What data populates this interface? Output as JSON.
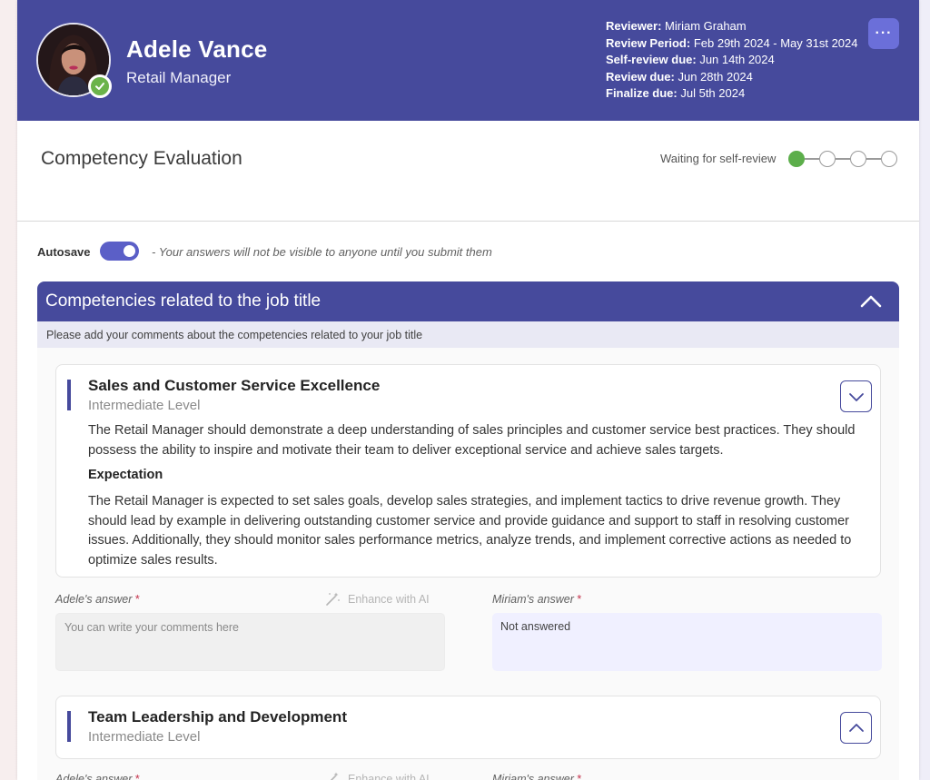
{
  "header": {
    "name": "Adele Vance",
    "role": "Retail Manager",
    "meta": [
      {
        "label": "Reviewer:",
        "value": "Miriam Graham"
      },
      {
        "label": "Review Period:",
        "value": "Feb 29th 2024 - May 31st 2024"
      },
      {
        "label": "Self-review due:",
        "value": "Jun 14th 2024"
      },
      {
        "label": "Review due:",
        "value": "Jun 28th 2024"
      },
      {
        "label": "Finalize due:",
        "value": "Jul 5th 2024"
      }
    ],
    "more_label": "···",
    "presence_icon": "check-icon",
    "colors": {
      "header_bg": "#464a9c",
      "accent": "#5b5fc7",
      "presence": "#6bb34a"
    }
  },
  "evaluation": {
    "title": "Competency Evaluation",
    "status": "Waiting for self-review",
    "steps_total": 4,
    "steps_done": 1
  },
  "autosave": {
    "label": "Autosave",
    "enabled": true,
    "note": "- Your answers will not be visible to anyone until you submit them"
  },
  "section": {
    "title": "Competencies related to the job title",
    "subtitle": "Please add your comments about the competencies related to your job title",
    "collapse_icon": "chevron-up-icon"
  },
  "competencies": [
    {
      "title": "Sales and Customer Service Excellence",
      "level": "Intermediate Level",
      "description": "The Retail Manager should demonstrate a deep understanding of sales principles and customer service best practices. They should possess the ability to inspire and motivate their team to deliver exceptional service and achieve sales targets.",
      "expectation_label": "Expectation",
      "expectation": "The Retail Manager is expected to set sales goals, develop sales strategies, and implement tactics to drive revenue growth. They should lead by example in delivering outstanding customer service and provide guidance and support to staff in resolving customer issues. Additionally, they should monitor sales performance metrics, analyze trends, and implement corrective actions as needed to optimize sales results.",
      "toggle_icon": "chevron-down-icon",
      "own_label": "Adele's answer",
      "other_label": "Miriam's answer",
      "required_mark": "*",
      "enhance_label": "Enhance with AI",
      "own_placeholder": "You can write your comments here",
      "other_value": "Not answered"
    },
    {
      "title": "Team Leadership and Development",
      "level": "Intermediate Level",
      "toggle_icon": "chevron-up-icon",
      "own_label": "Adele's answer",
      "other_label": "Miriam's answer",
      "required_mark": "*",
      "enhance_label": "Enhance with AI"
    }
  ]
}
